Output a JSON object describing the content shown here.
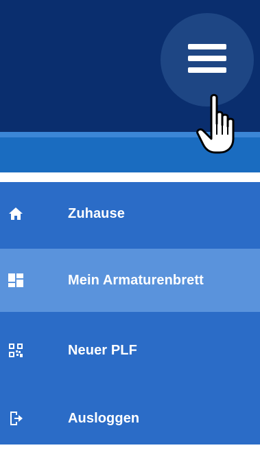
{
  "header": {
    "menu_button_icon": "hamburger-menu-icon",
    "cursor_icon": "hand-pointer-cursor",
    "colors": {
      "background": "#0a2e6e",
      "stripe": "#1a6cc0",
      "circle": "#1e4684"
    }
  },
  "sidebar": {
    "background": "#2b6cc7",
    "active_background": "#5a93dc",
    "items": [
      {
        "label": "Zuhause",
        "icon": "home-icon",
        "active": false
      },
      {
        "label": "Mein Armaturenbrett",
        "icon": "dashboard-icon",
        "active": true
      },
      {
        "label": "Neuer PLF",
        "icon": "qr-code-icon",
        "active": false
      },
      {
        "label": "Ausloggen",
        "icon": "logout-icon",
        "active": false
      }
    ]
  }
}
